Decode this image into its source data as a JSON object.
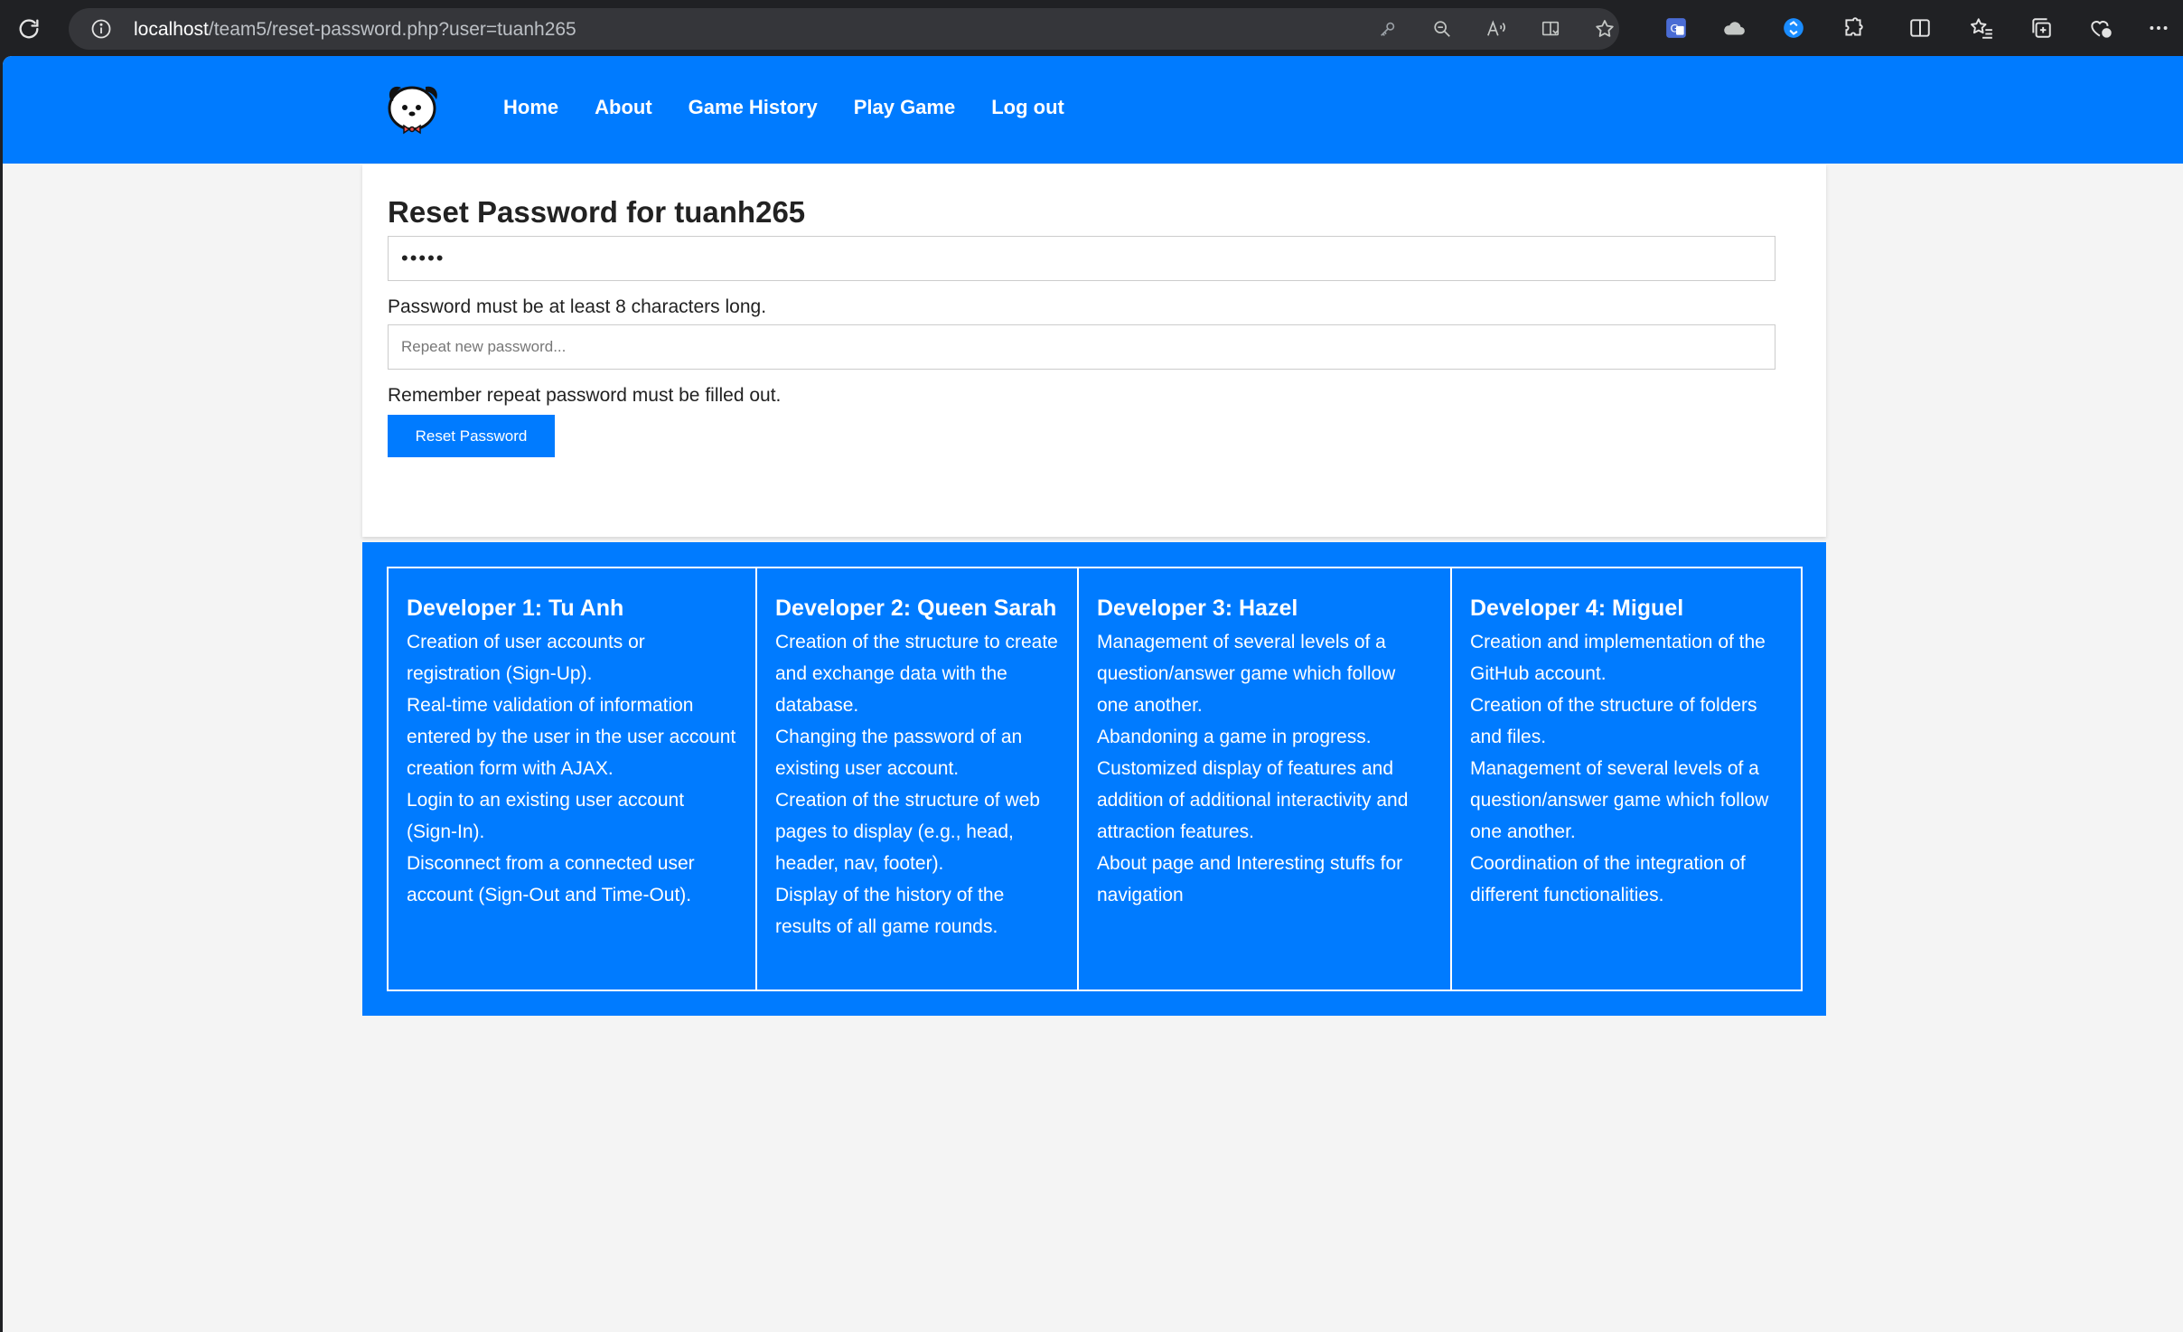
{
  "browser": {
    "url_host": "localhost",
    "url_path": "/team5/reset-password.php?user=tuanh265"
  },
  "nav": {
    "items": [
      {
        "label": "Home"
      },
      {
        "label": "About"
      },
      {
        "label": "Game History"
      },
      {
        "label": "Play Game"
      },
      {
        "label": "Log out"
      }
    ]
  },
  "form": {
    "title": "Reset Password for tuanh265",
    "password_value": "•••••",
    "password_hint": "Password must be at least 8 characters long.",
    "repeat_placeholder": "Repeat new password...",
    "repeat_hint": "Remember repeat password must be filled out.",
    "submit_label": "Reset Password"
  },
  "developers": [
    {
      "name": "Developer 1: Tu Anh",
      "tasks": [
        "Creation of user accounts or registration (Sign-Up).",
        "Real-time validation of information entered by the user in the user account creation form with AJAX.",
        "Login to an existing user account (Sign-In).",
        "Disconnect from a connected user account (Sign-Out and Time-Out)."
      ]
    },
    {
      "name": "Developer 2: Queen Sarah",
      "tasks": [
        "Creation of the structure to create and exchange data with the database.",
        "Changing the password of an existing user account.",
        "Creation of the structure of web pages to display (e.g., head, header, nav, footer).",
        "Display of the history of the results of all game rounds."
      ]
    },
    {
      "name": "Developer 3: Hazel",
      "tasks": [
        "Management of several levels of a question/answer game which follow one another.",
        "Abandoning a game in progress.",
        "Customized display of features and addition of additional interactivity and attraction features.",
        "About page and Interesting stuffs for navigation"
      ]
    },
    {
      "name": "Developer 4: Miguel",
      "tasks": [
        "Creation and implementation of the GitHub account.",
        "Creation of the structure of folders and files.",
        "Management of several levels of a question/answer game which follow one another.",
        "Coordination of the integration of different functionalities."
      ]
    }
  ]
}
